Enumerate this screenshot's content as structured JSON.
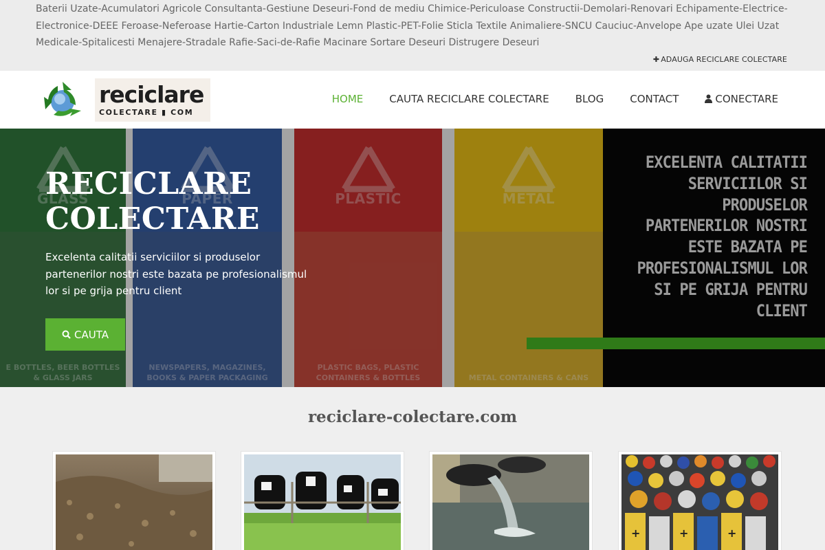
{
  "topbar": {
    "categories": [
      "Baterii Uzate-Acumulatori",
      "Agricole",
      "Consultanta-Gestiune Deseuri-Fond de mediu",
      "Chimice-Periculoase",
      "Constructii-Demolari-Renovari",
      "Echipamente-Electrice-Electronice-DEEE",
      "Feroase-Neferoase",
      "Hartie-Carton",
      "Industriale",
      "Lemn",
      "Plastic-PET-Folie",
      "Sticla",
      "Textile",
      "Animaliere-SNCU",
      "Cauciuc-Anvelope",
      "Ape uzate",
      "Ulei Uzat",
      "Medicale-Spitalicesti",
      "Menajere-Stradale",
      "Rafie-Saci-de-Rafie",
      "Macinare",
      "Sortare Deseuri",
      "Distrugere Deseuri"
    ],
    "add_link": "ADAUGA RECICLARE COLECTARE"
  },
  "logo": {
    "word": "reciclare",
    "sub": "COLECTARE ▮ COM"
  },
  "nav": {
    "home": "HOME",
    "search": "CAUTA RECICLARE COLECTARE",
    "blog": "BLOG",
    "contact": "CONTACT",
    "login": "CONECTARE"
  },
  "hero": {
    "title_line1": "RECICLARE",
    "title_line2": "COLECTARE",
    "text": "Excelenta calitatii serviciilor si produselor partenerilor nostri este bazata pe profesionalismul lor si pe grija pentru client",
    "button": "CAUTA",
    "panels": [
      {
        "label": "GLASS",
        "caption1": "E BOTTLES, BEER BOTTLES",
        "caption2": "& GLASS JARS",
        "top": "#1d6b2a",
        "bottom": "#2a6a35"
      },
      {
        "label": "PAPER",
        "caption1": "NEWSPAPERS, MAGAZINES,",
        "caption2": "BOOKS & PAPER PACKAGING",
        "top": "#234e9c",
        "bottom": "#2d4f8e"
      },
      {
        "label": "PLASTIC",
        "caption1": "PLASTIC BAGS, PLASTIC",
        "caption2": "CONTAINERS & BOTTLES",
        "top": "#c01a1a",
        "bottom": "#c0392b"
      },
      {
        "label": "METAL",
        "caption1": "METAL CONTAINERS & CANS",
        "caption2": "",
        "top": "#e7b900",
        "bottom": "#d6a81a"
      }
    ],
    "image_text": "EXCELENTA CALITATII SERVICIILOR SI PRODUSELOR PARTENERILOR NOSTRI ESTE BAZATA PE PROFESIONALISMUL LOR SI PE GRIJA PENTRU CLIENT"
  },
  "content": {
    "site_title": "reciclare-colectare.com"
  },
  "colors": {
    "accent": "#5bb133",
    "stripe": "#2f7a18"
  }
}
